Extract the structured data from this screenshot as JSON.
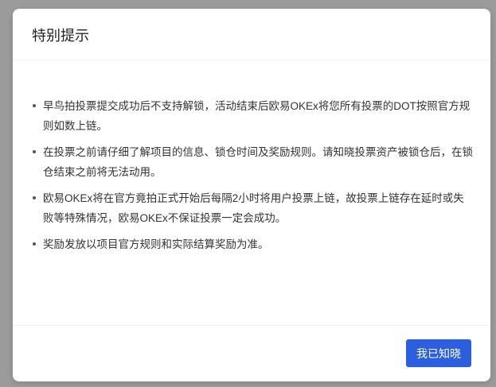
{
  "dialog": {
    "title": "特别提示",
    "items": [
      {
        "text": "早鸟拍投票提交成功后不支持解锁，活动结束后欧易OKEx将您所有投票的DOT按照官方规则如数上链。"
      },
      {
        "text": "在投票之前请仔细了解项目的信息、锁仓时间及奖励规则。请知晓投票资产被锁仓后，在锁仓结束之前将无法动用。"
      },
      {
        "text": "欧易OKEx将在官方竟拍正式开始后每隔2小时将用户投票上链，故投票上链存在延时或失败等特殊情况，欧易OKEx不保证投票一定会成功。"
      },
      {
        "text": "奖励发放以项目官方规则和实际结算奖励为准。"
      }
    ],
    "confirm_label": "我已知晓",
    "accent_color": "#2c5fe0"
  }
}
